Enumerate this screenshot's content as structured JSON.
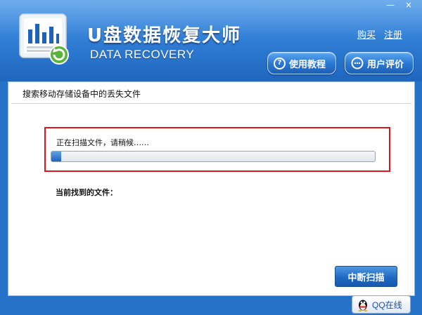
{
  "window": {
    "minimize_symbol": "—",
    "close_symbol": "×"
  },
  "header": {
    "title": "U盘数据恢复大师",
    "subtitle": "DATA RECOVERY",
    "links": {
      "buy": "购买",
      "register": "注册"
    },
    "buttons": {
      "tutorial": {
        "label": "使用教程",
        "icon": "question-icon"
      },
      "review": {
        "label": "用户评价",
        "icon": "chat-icon"
      }
    }
  },
  "panel": {
    "heading": "搜索移动存储设备中的丢失文件",
    "scan_status": "正在扫描文件，请稍候……",
    "progress_fraction": 0.012,
    "found_label": "当前找到的文件：",
    "stop_button": "中断扫描"
  },
  "footer": {
    "qq_label": "QQ在线",
    "qq_icon": "qq-penguin-icon"
  },
  "colors": {
    "header_blue": "#2e7bd3",
    "highlight_red": "#e0141c",
    "button_blue": "#2069c4"
  }
}
